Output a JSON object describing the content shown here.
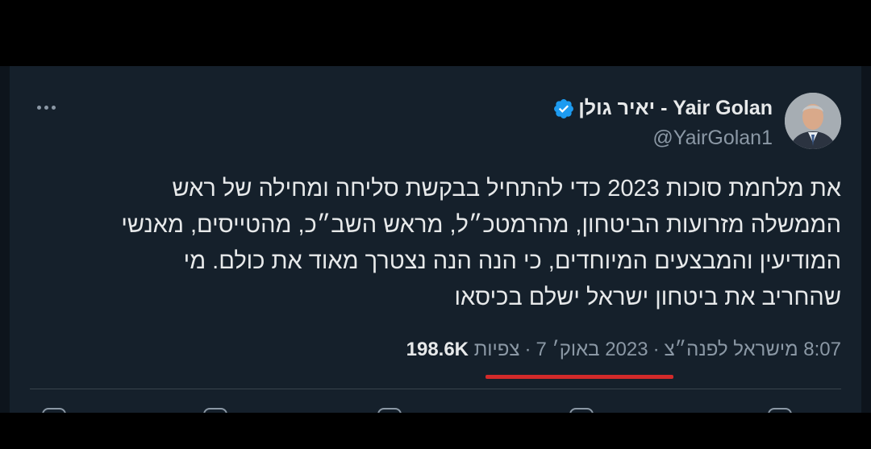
{
  "tweet": {
    "display_name": "יאיר גולן - Yair Golan",
    "handle": "@YairGolan1",
    "body_lines": [
      "את מלחמת סוכות 2023 כדי להתחיל בבקשת סליחה ומחילה של ראש",
      "הממשלה מזרועות הביטחון, מהרמטכ״ל, מראש השב״כ, מהטייסים, מאנשי",
      "המודיעין והמבצעים המיוחדים, כי הנה הנה נצטרך מאוד את כולם. מי",
      "שהחריב את ביטחון ישראל ישלם בכיסאו"
    ],
    "time": "8:07",
    "date": "2023 באוק׳ 7",
    "source": "מישראל לפנה״צ",
    "views_count": "198.6K",
    "views_label": "צפיות"
  },
  "colors": {
    "background": "#000000",
    "card": "#15202b",
    "text": "#e7e9ea",
    "muted": "#8b98a5",
    "verified": "#1d9bf0",
    "underline": "#d32a2a"
  },
  "icons": {
    "verified": "verified-badge-icon",
    "more": "more-dots-icon"
  }
}
